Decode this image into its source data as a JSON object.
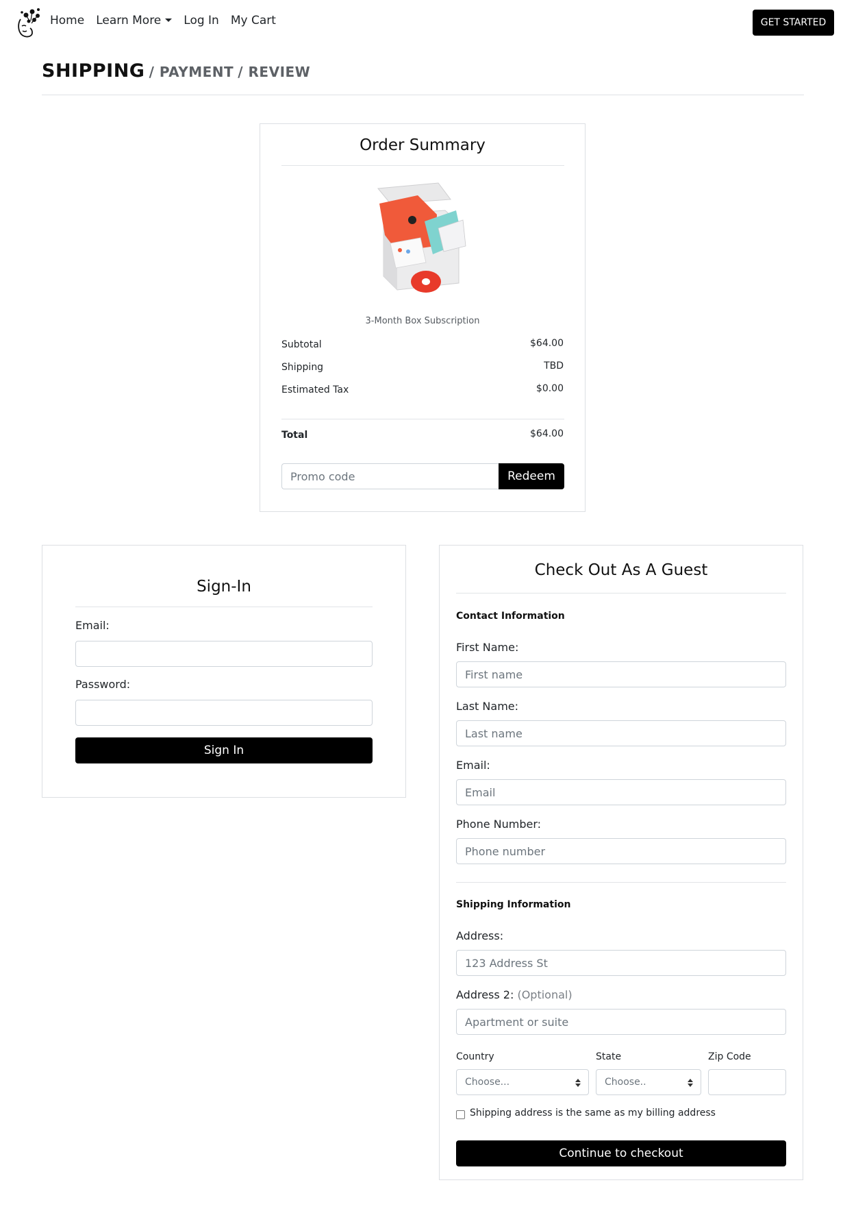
{
  "navbar": {
    "links": [
      {
        "label": "Home"
      },
      {
        "label": "Learn More"
      },
      {
        "label": "Log In"
      },
      {
        "label": "My Cart"
      }
    ],
    "cta_label": "GET STARTED"
  },
  "steps": {
    "active": "SHIPPING",
    "separator": " / ",
    "payment": "PAYMENT",
    "review": "REVIEW"
  },
  "order_summary": {
    "title": "Order Summary",
    "product_name": "3-Month Box Subscription",
    "subtotal_label": "Subtotal",
    "subtotal_value": "$64.00",
    "shipping_label": "Shipping",
    "shipping_value": "TBD",
    "tax_label": "Estimated Tax",
    "tax_value": "$0.00",
    "total_label": "Total",
    "total_value": "$64.00",
    "promo_placeholder": "Promo code",
    "redeem_label": "Redeem"
  },
  "signin": {
    "title": "Sign-In",
    "email_label": "Email:",
    "password_label": "Password:",
    "button_label": "Sign In"
  },
  "guest": {
    "title": "Check Out As A Guest",
    "contact_heading": "Contact Information",
    "first_name_label": "First Name:",
    "first_name_placeholder": "First name",
    "last_name_label": "Last Name:",
    "last_name_placeholder": "Last name",
    "email_label": "Email:",
    "email_placeholder": "Email",
    "phone_label": "Phone Number:",
    "phone_placeholder": "Phone number",
    "shipping_heading": "Shipping Information",
    "address_label": "Address:",
    "address_placeholder": "123 Address St",
    "address2_label": "Address 2:",
    "address2_optional": "(Optional)",
    "address2_placeholder": "Apartment or suite",
    "country_label": "Country",
    "country_value": "Choose...",
    "state_label": "State",
    "state_value": "Choose..",
    "zip_label": "Zip Code",
    "same_address_label": "Shipping address is the same as my billing address",
    "continue_label": "Continue to checkout"
  },
  "colors": {
    "button_bg": "#000000",
    "border": "#ced4da",
    "step_inactive": "#5d6166",
    "product_accent": "#f05a3a"
  }
}
